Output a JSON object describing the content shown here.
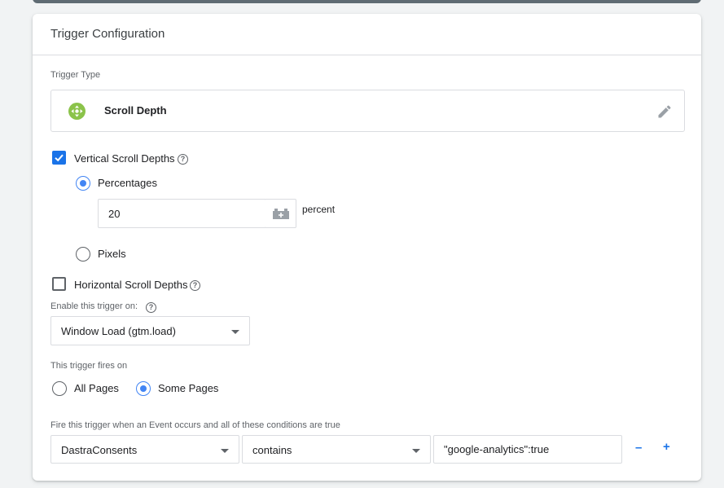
{
  "card": {
    "title": "Trigger Configuration"
  },
  "trigger_type": {
    "label": "Trigger Type",
    "name": "Scroll Depth",
    "icon": "scroll-depth-icon",
    "icon_color": "#8bc34a",
    "edit_icon": "pencil-icon"
  },
  "vertical": {
    "label": "Vertical Scroll Depths",
    "checked": true,
    "help_glyph": "?",
    "options": {
      "percentages": {
        "label": "Percentages",
        "selected": true
      },
      "pixels": {
        "label": "Pixels",
        "selected": false
      }
    },
    "percent_value": "20",
    "unit_label": "percent",
    "variable_icon": "variable-picker-icon"
  },
  "horizontal": {
    "label": "Horizontal Scroll Depths",
    "checked": false,
    "help_glyph": "?"
  },
  "enable_on": {
    "label": "Enable this trigger on:",
    "help_glyph": "?",
    "selected": "Window Load (gtm.load)"
  },
  "fires_on": {
    "label": "This trigger fires on",
    "options": {
      "all_pages": {
        "label": "All Pages",
        "selected": false
      },
      "some_pages": {
        "label": "Some Pages",
        "selected": true
      }
    }
  },
  "condition": {
    "label": "Fire this trigger when an Event occurs and all of these conditions are true",
    "variable": "DastraConsents",
    "operator": "contains",
    "value": "\"google-analytics\":true",
    "remove_glyph": "–",
    "add_glyph": "+"
  },
  "colors": {
    "accent": "#1a73e8",
    "radio_accent": "#4285f4"
  }
}
